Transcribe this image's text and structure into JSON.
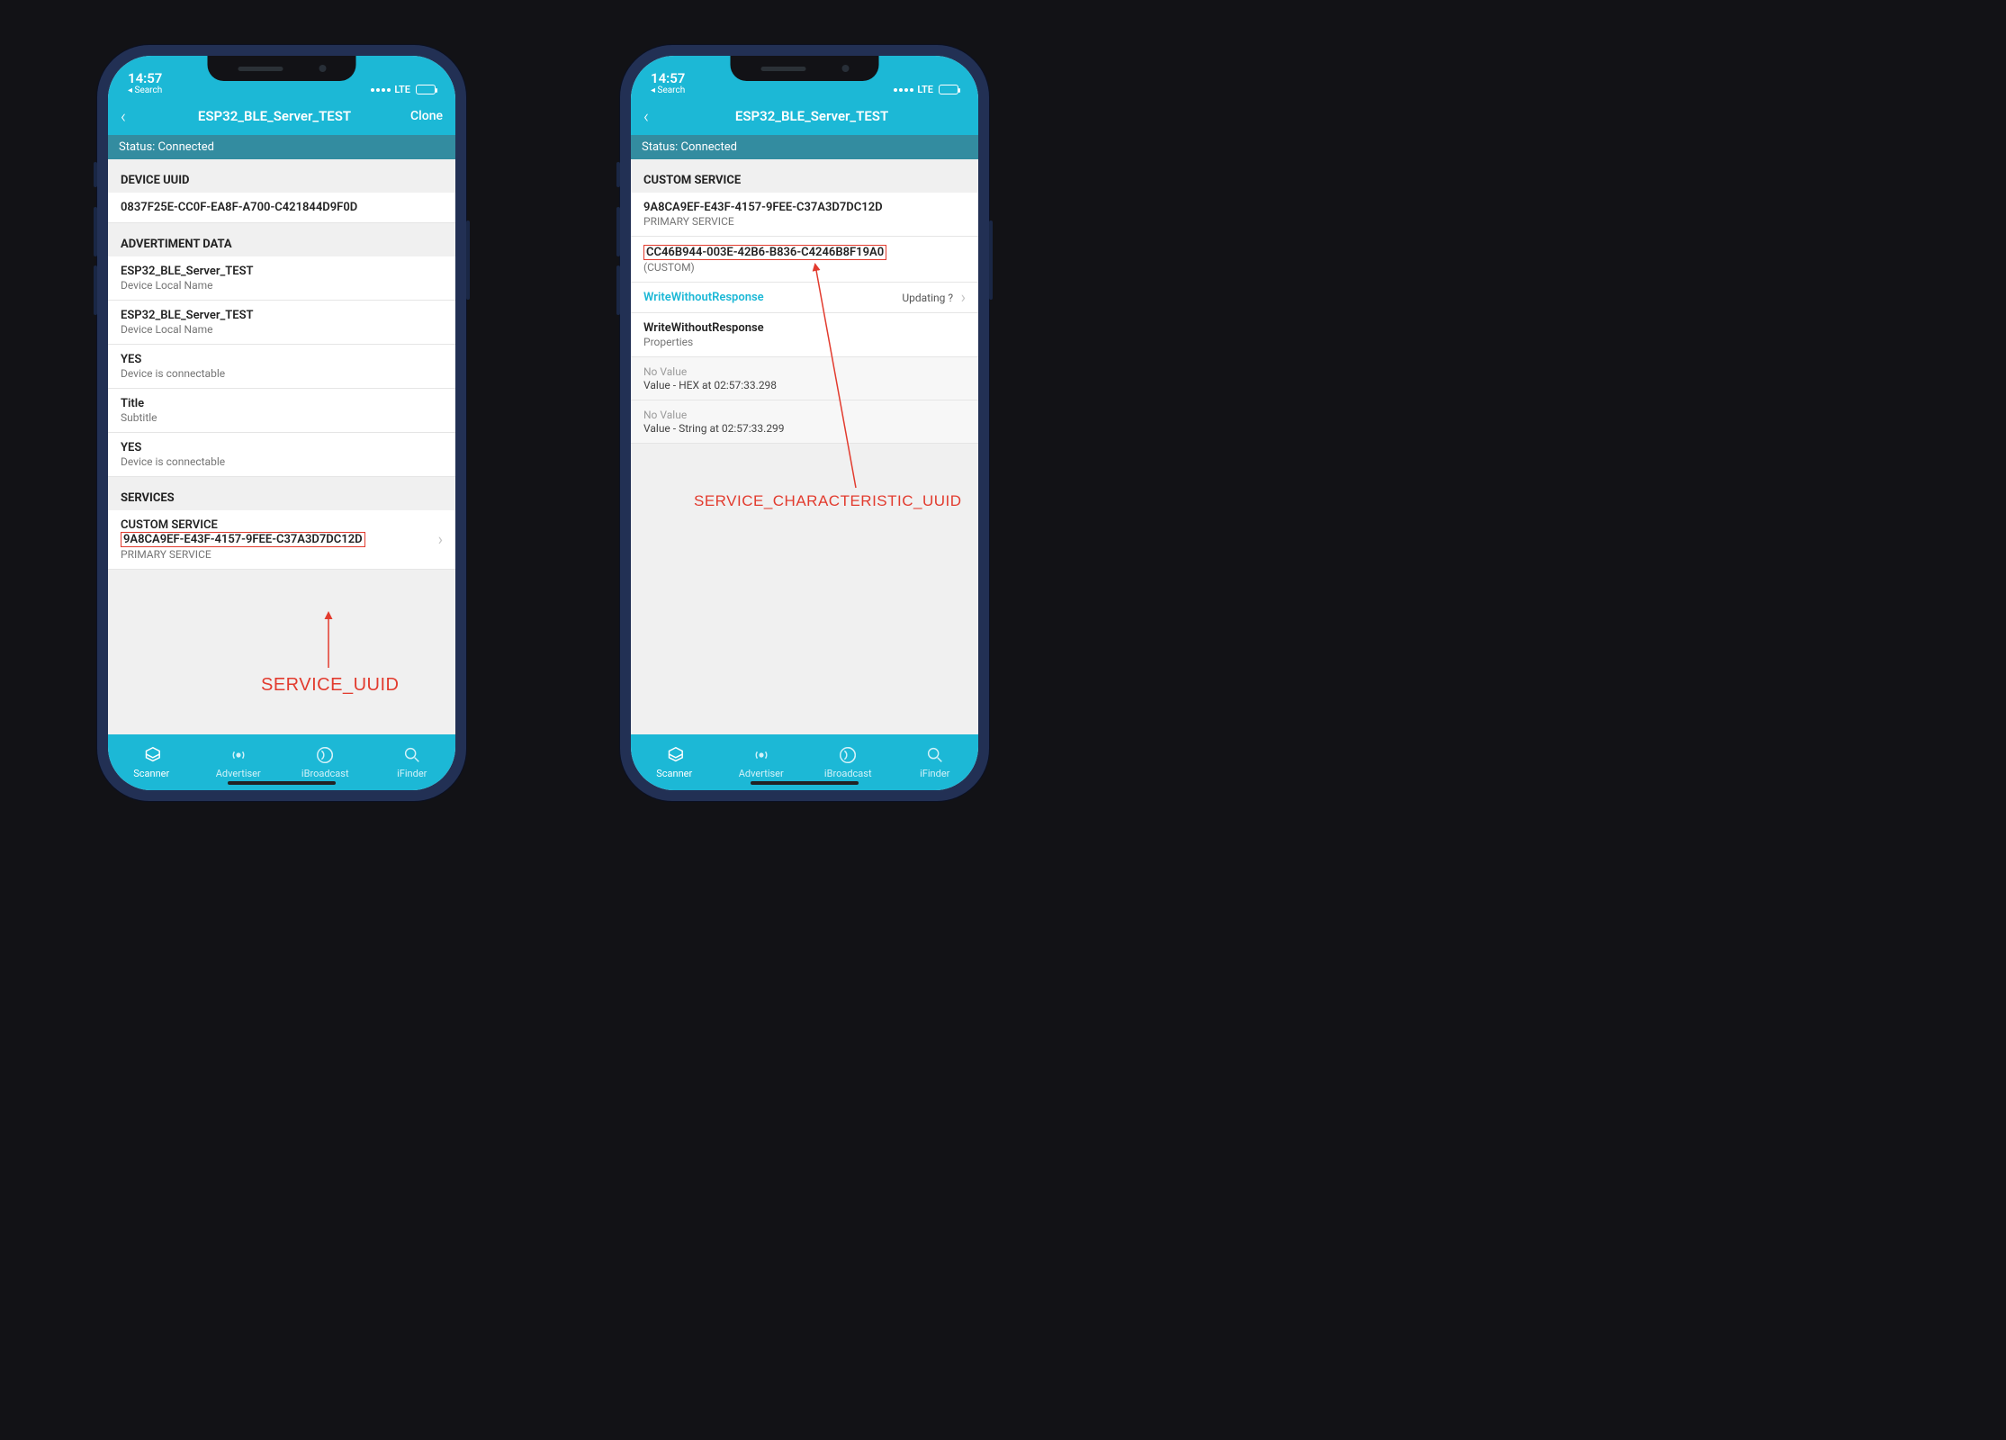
{
  "statusbar": {
    "time": "14:57",
    "back_hint": "◂ Search",
    "network": "LTE"
  },
  "nav": {
    "title": "ESP32_BLE_Server_TEST",
    "clone": "Clone",
    "status_label": "Status: Connected"
  },
  "left": {
    "device_uuid_header": "DEVICE UUID",
    "device_uuid": "0837F25E-CC0F-EA8F-A700-C421844D9F0D",
    "adv_header": "ADVERTIMENT DATA",
    "adv": [
      {
        "p": "ESP32_BLE_Server_TEST",
        "s": "Device Local Name"
      },
      {
        "p": "ESP32_BLE_Server_TEST",
        "s": "Device Local Name"
      },
      {
        "p": "YES",
        "s": "Device is connectable"
      },
      {
        "p": "Title",
        "s": "Subtitle"
      },
      {
        "p": "YES",
        "s": "Device is connectable"
      }
    ],
    "services_header": "SERVICES",
    "service_name": "CUSTOM SERVICE",
    "service_uuid": "9A8CA9EF-E43F-4157-9FEE-C37A3D7DC12D",
    "service_type": "PRIMARY SERVICE",
    "anno": "SERVICE_UUID"
  },
  "right": {
    "custom_header": "CUSTOM SERVICE",
    "service_uuid": "9A8CA9EF-E43F-4157-9FEE-C37A3D7DC12D",
    "service_type": "PRIMARY SERVICE",
    "char_uuid": "CC46B944-003E-42B6-B836-C4246B8F19A0",
    "char_note": "(CUSTOM)",
    "wwr_link": "WriteWithoutResponse",
    "updating": "Updating ?",
    "wwr2": "WriteWithoutResponse",
    "wwr2_sub": "Properties",
    "hex_no": "No Value",
    "hex_sub": "Value - HEX at 02:57:33.298",
    "str_no": "No Value",
    "str_sub": "Value - String at 02:57:33.299",
    "anno": "SERVICE_CHARACTERISTIC_UUID"
  },
  "tabs": {
    "scanner": "Scanner",
    "advertiser": "Advertiser",
    "ibroadcast": "iBroadcast",
    "ifinder": "iFinder"
  }
}
